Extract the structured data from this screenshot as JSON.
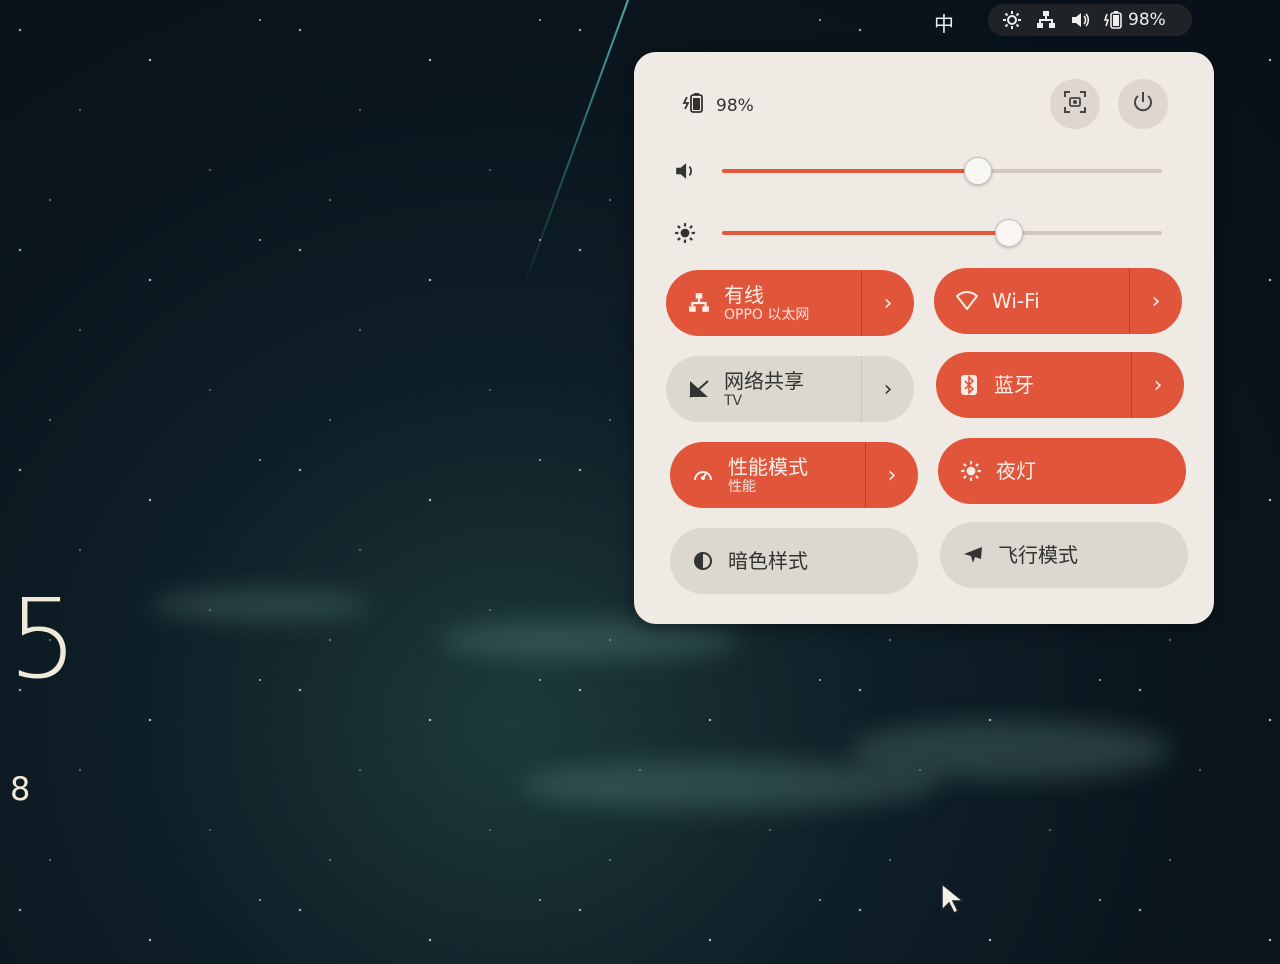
{
  "topbar": {
    "ime": "中",
    "battery": "98%",
    "icons": [
      "brightness-icon",
      "network-icon",
      "volume-icon",
      "battery-icon"
    ]
  },
  "desktop": {
    "clock_big": "5",
    "clock_small": "8"
  },
  "panel": {
    "battery_label": "98%",
    "screenshot_icon": "screenshot-icon",
    "power_icon": "power-icon",
    "volume_level": 0.58,
    "brightness_level": 0.65,
    "tiles": [
      {
        "title": "有线",
        "subtitle": "OPPO 以太网",
        "icon": "wired-network-icon",
        "on": true,
        "arrow": "›"
      },
      {
        "title": "Wi-Fi",
        "subtitle": "",
        "icon": "wifi-icon",
        "on": true,
        "arrow": "›"
      },
      {
        "title": "网络共享",
        "subtitle": "TV",
        "icon": "hotspot-icon",
        "on": false,
        "arrow": "›"
      },
      {
        "title": "蓝牙",
        "subtitle": "",
        "icon": "bluetooth-icon",
        "on": true,
        "arrow": "›"
      },
      {
        "title": "性能模式",
        "subtitle": "性能",
        "icon": "performance-icon",
        "on": true,
        "arrow": "›"
      },
      {
        "title": "夜灯",
        "subtitle": "",
        "icon": "night-light-icon",
        "on": true
      },
      {
        "title": "暗色样式",
        "subtitle": "",
        "icon": "dark-style-icon",
        "on": false
      },
      {
        "title": "飞行模式",
        "subtitle": "",
        "icon": "airplane-icon",
        "on": false
      }
    ]
  },
  "colors": {
    "accent": "#e1553a",
    "panel_bg": "#efeae4",
    "tile_off": "#dcd7cf"
  }
}
